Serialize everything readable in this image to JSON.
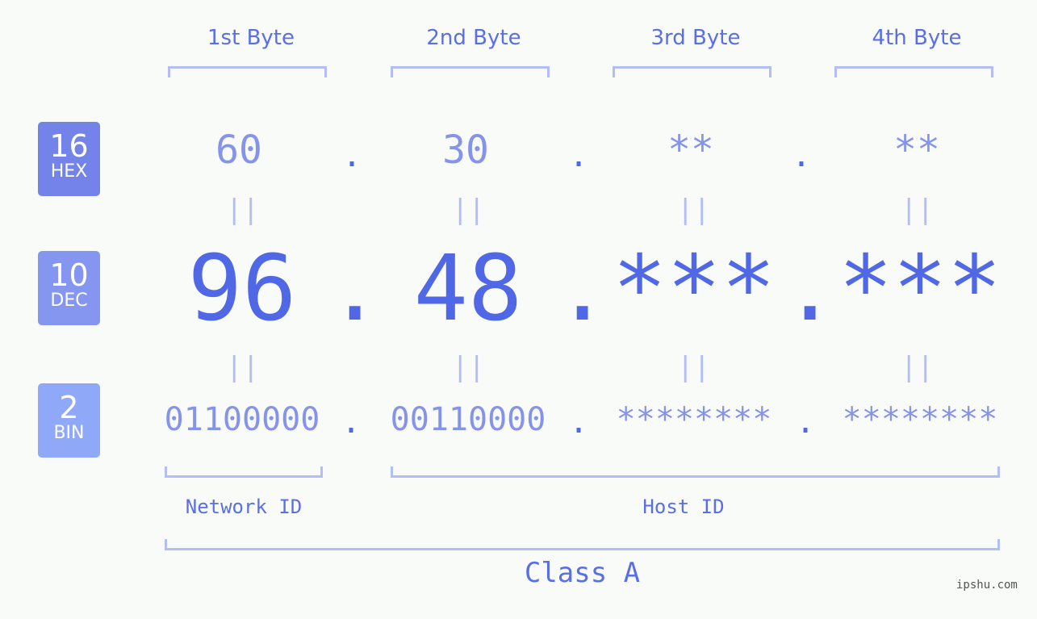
{
  "ip": "96.48.***.***",
  "headers": [
    "1st Byte",
    "2nd Byte",
    "3rd Byte",
    "4th Byte"
  ],
  "badges": {
    "hex": {
      "num": "16",
      "label": "HEX",
      "color": "#7383ea"
    },
    "dec": {
      "num": "10",
      "label": "DEC",
      "color": "#8496f0"
    },
    "bin": {
      "num": "2",
      "label": "BIN",
      "color": "#90a8f8"
    }
  },
  "hex": [
    "60",
    "30",
    "**",
    "**"
  ],
  "dec": [
    "96",
    "48",
    "***",
    "***"
  ],
  "bin": [
    "01100000",
    "00110000",
    "********",
    "********"
  ],
  "separator": ".",
  "equals": "||",
  "network_label": "Network ID",
  "host_label": "Host ID",
  "class_label": "Class A",
  "watermark": "ipshu.com",
  "colors": {
    "accent": "#5068e6",
    "light": "#8593ea",
    "bracket": "#b3bdf6"
  }
}
